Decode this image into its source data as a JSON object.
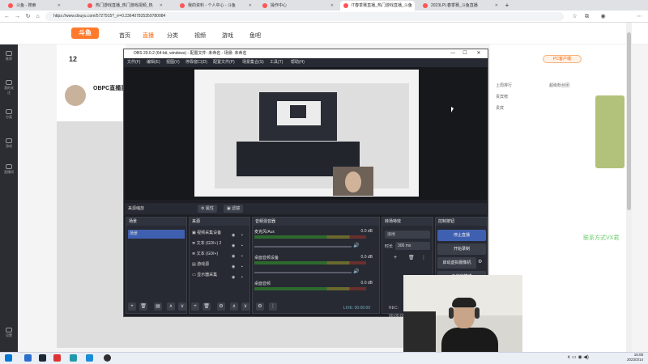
{
  "browser": {
    "tabs": [
      {
        "label": "斗鱼 - 搜索"
      },
      {
        "label": "热门游戏直播_热门游戏视频_热"
      },
      {
        "label": "我的资料 - 个人中心 - 斗鱼"
      },
      {
        "label": "操作中心"
      },
      {
        "label": "lT春季赛直播_热门游戏直播_斗鱼"
      },
      {
        "label": "2023LPL春季赛_斗鱼直播"
      }
    ],
    "url": "https://www.douyu.com/5727915?_rr=0.236407825359780084"
  },
  "site": {
    "nav": [
      "首页",
      "直播",
      "分类",
      "视频",
      "游戏",
      "鱼吧"
    ],
    "left_icons": [
      "推荐",
      "我的关注",
      "分类",
      "游戏",
      "直播间",
      "设置"
    ],
    "room_count": "12",
    "room_title": "OBPC直播测试",
    "pc_button": "PC客户端",
    "right_texts": [
      "上周排行",
      "超级粉丝团",
      "贵宾榜",
      "贵宾"
    ],
    "vx_text": "联系方式VX君"
  },
  "obs": {
    "title": "OBS 29.0.2 (64-bit, windows) - 配置文件: 未命名 - 场景: 未命名",
    "menu": [
      "文件(F)",
      "编辑(E)",
      "视图(V)",
      "停靠窗口(D)",
      "配置文件(P)",
      "场景集合(S)",
      "工具(T)",
      "帮助(H)"
    ],
    "scene_label": "来源缩放",
    "props_btn": "属性",
    "filter_btn": "滤镜",
    "panels": {
      "scenes": {
        "title": "场景",
        "items": [
          "场景"
        ]
      },
      "sources": {
        "title": "来源",
        "items": [
          "视频采集设备",
          "文本 (GDI+) 2",
          "文本 (GDI+)",
          "游戏源",
          "显示器采集"
        ]
      },
      "mixer": {
        "title": "音频混音器",
        "channels": [
          {
            "name": "麦克风/Aux",
            "db": "0.0 dB"
          },
          {
            "name": "桌面音频设备",
            "db": "0.0 dB"
          },
          {
            "name": "桌面音频",
            "db": "0.0 dB"
          }
        ]
      },
      "transitions": {
        "title": "转场特效",
        "type": "淡出",
        "duration_label": "时长",
        "duration": "300 ms"
      },
      "controls": {
        "title": "控制按钮",
        "buttons": [
          "停止直播",
          "开始录制",
          "启动虚拟摄像机",
          "工作室模式"
        ]
      }
    },
    "status": {
      "live": "LIVE: 00:00:00",
      "rec": "REC: 00:00:00"
    }
  },
  "taskbar": {
    "time": "16:08",
    "date": "2023/3/14"
  }
}
